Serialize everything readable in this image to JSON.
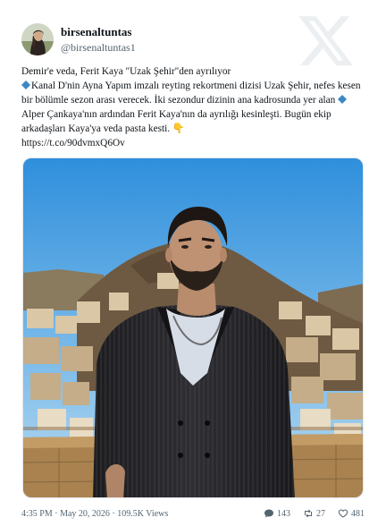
{
  "user": {
    "display_name": "birsenaltuntas",
    "handle": "@birsenaltuntas1"
  },
  "tweet": {
    "line1": "Demir'e veda, Ferit Kaya \"Uzak Şehir\"den ayrılıyor",
    "para_a": "Kanal D'nin Ayna Yapım imzalı reyting rekortmeni dizisi Uzak Şehir, nefes kesen bir bölümle sezon arası verecek. İki sezondur dizinin ana kadrosunda yer alan ",
    "para_b": "Alper Çankaya'nın ardından Ferit Kaya'nın da ayrılığı kesinleşti. Bugün ekip arkadaşları Kaya'ya veda pasta kesti. ",
    "emoji": "👇",
    "link": "https://t.co/90dvmxQ6Ov"
  },
  "footer": {
    "time": "4:35 PM",
    "date": "May 20, 2026",
    "views": "109.5K Views",
    "replies": "143",
    "retweets": "27",
    "likes": "481"
  },
  "icons": {
    "brand": "x-logo-icon",
    "diamond": "small-blue-diamond-icon",
    "reply": "reply-icon",
    "retweet": "retweet-icon",
    "like": "heart-icon"
  },
  "colors": {
    "text": "#0f1419",
    "muted": "#536471",
    "diamond": "#3b88c3",
    "logo": "#eceff1"
  }
}
